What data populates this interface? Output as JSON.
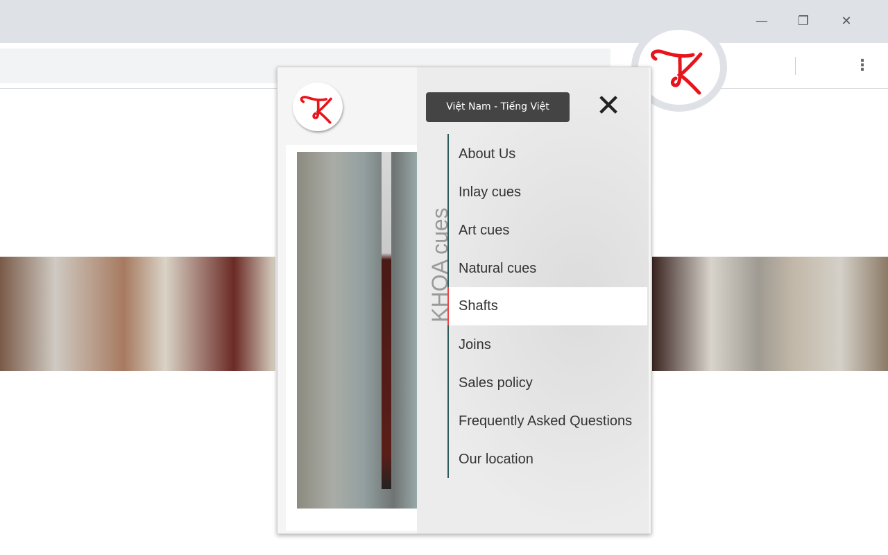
{
  "window": {
    "minimize": "—",
    "restore": "❐",
    "close": "✕",
    "menu": "⋮"
  },
  "logo": {
    "alt": "K"
  },
  "popup": {
    "language_button": "Việt Nam - Tiếng Việt",
    "close": "✕",
    "brand": "KHOA cues",
    "menu": [
      {
        "label": "About Us"
      },
      {
        "label": "Inlay cues"
      },
      {
        "label": "Art cues"
      },
      {
        "label": "Natural cues"
      },
      {
        "label": "Shafts",
        "active": true
      },
      {
        "label": "Joins"
      },
      {
        "label": "Sales policy"
      },
      {
        "label": "Frequently Asked Questions"
      },
      {
        "label": "Our location"
      }
    ]
  },
  "colors": {
    "accent": "#e44444",
    "logo": "#e8141c",
    "menu_line": "#2f5a5a",
    "lang_bg": "#444444"
  }
}
